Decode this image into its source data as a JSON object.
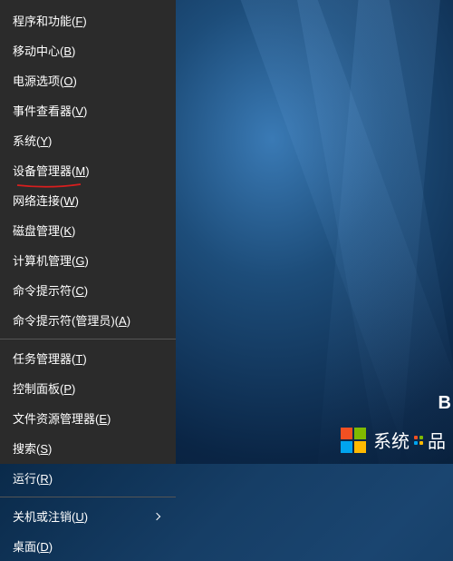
{
  "menu": {
    "groups": [
      [
        {
          "label": "程序和功能",
          "key": "F",
          "submenu": false
        },
        {
          "label": "移动中心",
          "key": "B",
          "submenu": false
        },
        {
          "label": "电源选项",
          "key": "O",
          "submenu": false
        },
        {
          "label": "事件查看器",
          "key": "V",
          "submenu": false
        },
        {
          "label": "系统",
          "key": "Y",
          "submenu": false
        },
        {
          "label": "设备管理器",
          "key": "M",
          "submenu": false
        },
        {
          "label": "网络连接",
          "key": "W",
          "submenu": false,
          "annotated": true
        },
        {
          "label": "磁盘管理",
          "key": "K",
          "submenu": false
        },
        {
          "label": "计算机管理",
          "key": "G",
          "submenu": false
        },
        {
          "label": "命令提示符",
          "key": "C",
          "submenu": false
        },
        {
          "label": "命令提示符(管理员)",
          "key": "A",
          "submenu": false
        }
      ],
      [
        {
          "label": "任务管理器",
          "key": "T",
          "submenu": false
        },
        {
          "label": "控制面板",
          "key": "P",
          "submenu": false
        },
        {
          "label": "文件资源管理器",
          "key": "E",
          "submenu": false
        },
        {
          "label": "搜索",
          "key": "S",
          "submenu": false
        },
        {
          "label": "运行",
          "key": "R",
          "submenu": false
        }
      ],
      [
        {
          "label": "关机或注销",
          "key": "U",
          "submenu": true
        },
        {
          "label": "桌面",
          "key": "D",
          "submenu": false
        }
      ]
    ]
  },
  "watermark": {
    "text_left": "系统",
    "text_right": "品"
  },
  "partial_edge_text": "B",
  "annotation": {
    "color": "#d81e1e"
  }
}
